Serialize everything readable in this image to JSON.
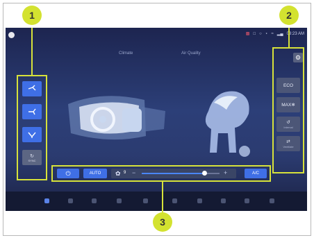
{
  "tabs": {
    "climate": "Climate",
    "air_quality": "Air Quality"
  },
  "status": {
    "time": "08:23 AM"
  },
  "left_panel": {
    "sync_label": "SYNC"
  },
  "right_panel": {
    "eco_label": "ECO",
    "max_label": "MAX",
    "internal_label": "Internal",
    "ventilation_label": "Ventilate"
  },
  "bottom": {
    "auto_label": "AUTO",
    "fan_level": "9",
    "fan_fill_fraction": 0.8,
    "ac_label": "A/C"
  },
  "callouts": {
    "one": "1",
    "two": "2",
    "three": "3"
  },
  "colors": {
    "accent": "#3f6fe6",
    "highlight": "#d7e23a"
  }
}
